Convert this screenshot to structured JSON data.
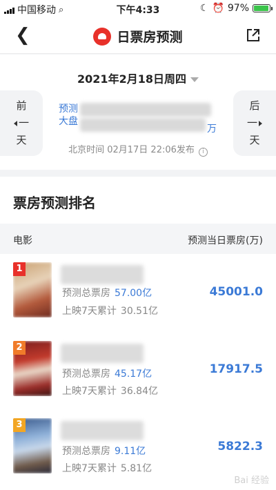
{
  "status": {
    "carrier": "中国移动",
    "time": "下午4:33",
    "battery_pct": "97%",
    "battery_level": 0.97
  },
  "nav": {
    "title": "日票房预测"
  },
  "header": {
    "date": "2021年2月18日周四",
    "prev_label_1": "前",
    "prev_label_2": "一",
    "prev_label_3": "天",
    "next_label_1": "后",
    "next_label_2": "一",
    "next_label_3": "天",
    "pred_line1": "预测",
    "pred_line2": "大盘",
    "pred_unit": "万",
    "publish": "北京时间 02月17日 22:06发布"
  },
  "ranking": {
    "title": "票房预测排名",
    "col_movie": "电影",
    "col_forecast": "预测当日票房(万)",
    "total_label": "预测总票房",
    "cum_label": "上映7天累计",
    "rows": [
      {
        "rank": "1",
        "total": "57.00亿",
        "cumulative": "30.51亿",
        "forecast": "45001.0",
        "badge_color": "#e8312a"
      },
      {
        "rank": "2",
        "total": "45.17亿",
        "cumulative": "36.84亿",
        "forecast": "17917.5",
        "badge_color": "#f07b2a"
      },
      {
        "rank": "3",
        "total": "9.11亿",
        "cumulative": "5.81亿",
        "forecast": "5822.3",
        "badge_color": "#f2a624"
      }
    ]
  },
  "watermark": "Bai 经验"
}
